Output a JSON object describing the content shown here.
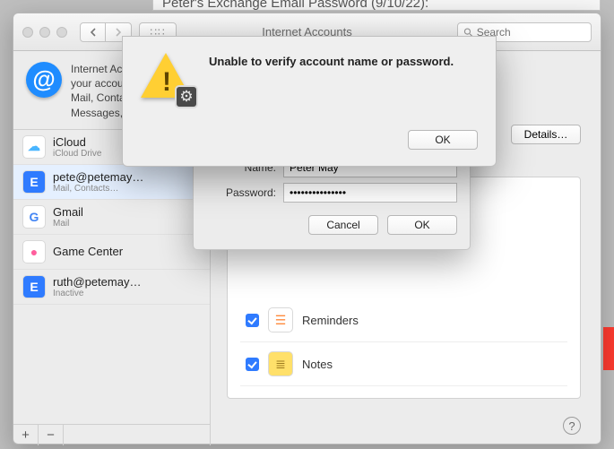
{
  "underlying_title": "Peter's Exchange Email Password (9/10/22):",
  "toolbar": {
    "title": "Internet Accounts",
    "search_placeholder": "Search"
  },
  "intro_text": "Internet Accounts sets up your accounts to use with Mail, Contacts, Calendar, Messages, and other apps.",
  "accounts": [
    {
      "name": "iCloud",
      "sub": "iCloud Drive",
      "icon": "cloud",
      "bg": "#ffffff",
      "fg": "#49b5ff",
      "selected": false
    },
    {
      "name": "pete@petemay…",
      "sub": "Mail, Contacts…",
      "icon": "E",
      "bg": "#2f7bff",
      "fg": "#ffffff",
      "selected": true
    },
    {
      "name": "Gmail",
      "sub": "Mail",
      "icon": "G",
      "bg": "#ffffff",
      "fg": "#4285f4",
      "selected": false
    },
    {
      "name": "Game Center",
      "sub": "",
      "icon": "●",
      "bg": "#ffffff",
      "fg": "#ff5e9d",
      "selected": false
    },
    {
      "name": "ruth@petemay…",
      "sub": "Inactive",
      "icon": "E",
      "bg": "#2f7bff",
      "fg": "#ffffff",
      "selected": false
    }
  ],
  "details_label": "Details…",
  "apps": [
    {
      "label": "Reminders",
      "checked": true,
      "ic_bg": "#ffffff",
      "ic_glyph": "☰",
      "ic_fg": "#ff8a3c"
    },
    {
      "label": "Notes",
      "checked": true,
      "ic_bg": "#ffe06a",
      "ic_glyph": "≣",
      "ic_fg": "#9c7a1e"
    }
  ],
  "alert": {
    "message": "Unable to verify account name or password.",
    "ok": "OK"
  },
  "cred": {
    "name_label": "Name:",
    "name_value": "Peter May",
    "password_label": "Password:",
    "password_value": "•••••••••••••••",
    "cancel": "Cancel",
    "ok": "OK"
  },
  "footer": {
    "add": "+",
    "remove": "−"
  },
  "help_glyph": "?"
}
